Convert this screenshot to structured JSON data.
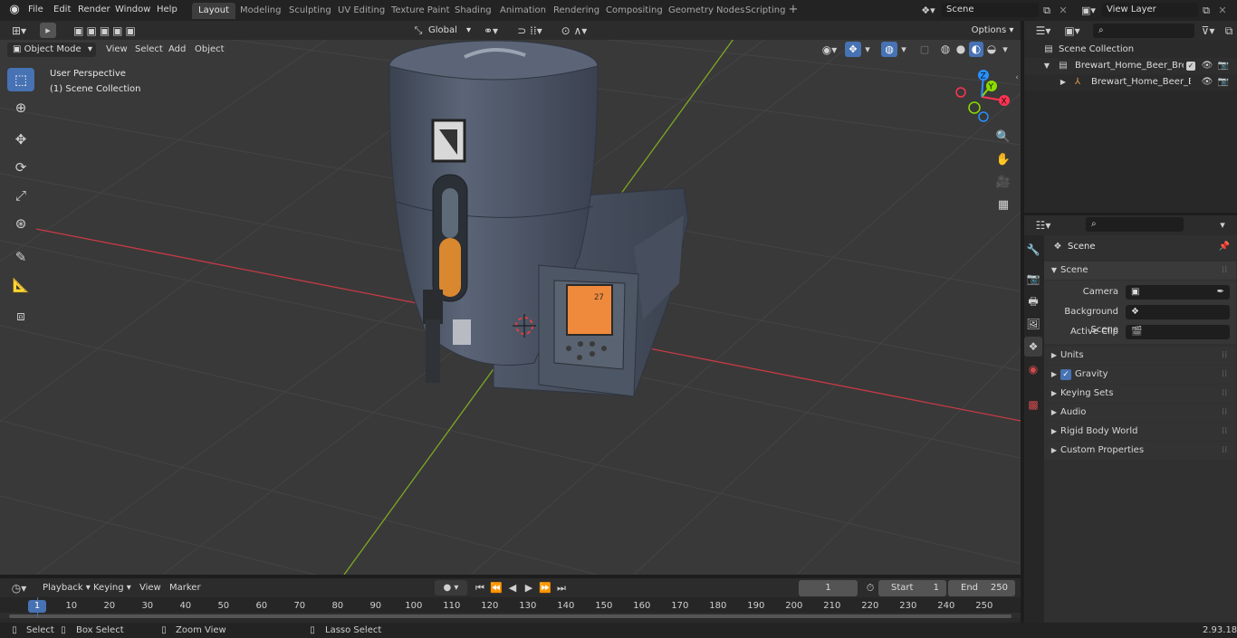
{
  "topbar": {
    "menus": [
      "File",
      "Edit",
      "Render",
      "Window",
      "Help"
    ],
    "workspaces": [
      "Layout",
      "Modeling",
      "Sculpting",
      "UV Editing",
      "Texture Paint",
      "Shading",
      "Animation",
      "Rendering",
      "Compositing",
      "Geometry Nodes",
      "Scripting"
    ],
    "active_workspace": "Layout",
    "scene_name": "Scene",
    "view_layer_name": "View Layer"
  },
  "viewport_header": {
    "mode": "Object Mode",
    "menus": [
      "View",
      "Select",
      "Add",
      "Object"
    ],
    "transform_orientation": "Global",
    "options_label": "Options"
  },
  "viewport": {
    "perspective_label": "User Perspective",
    "collection_label": "(1) Scene Collection",
    "gizmo_axes": [
      "X",
      "Y",
      "Z"
    ],
    "device_display": "27"
  },
  "outliner": {
    "root": "Scene Collection",
    "items": [
      {
        "label": "Brewart_Home_Beer_Brewing"
      },
      {
        "label": "Brewart_Home_Beer_Bre"
      }
    ]
  },
  "properties": {
    "context_title": "Scene",
    "panel_title": "Scene",
    "fields": [
      {
        "label": "Camera"
      },
      {
        "label": "Background Scene"
      },
      {
        "label": "Active Clip"
      }
    ],
    "subpanels": [
      "Units",
      "Gravity",
      "Keying Sets",
      "Audio",
      "Rigid Body World",
      "Custom Properties"
    ],
    "gravity_checked": true
  },
  "timeline": {
    "menus": [
      "Playback",
      "Keying",
      "View",
      "Marker"
    ],
    "current_frame": "1",
    "start_label": "Start",
    "start_value": "1",
    "end_label": "End",
    "end_value": "250",
    "ticks": [
      "1",
      "10",
      "20",
      "30",
      "40",
      "50",
      "60",
      "70",
      "80",
      "90",
      "100",
      "110",
      "120",
      "130",
      "140",
      "150",
      "160",
      "170",
      "180",
      "190",
      "200",
      "210",
      "220",
      "230",
      "240",
      "250"
    ]
  },
  "statusbar": {
    "select": "Select",
    "box_select": "Box Select",
    "zoom_view": "Zoom View",
    "lasso_select": "Lasso Select",
    "version": "2.93.18"
  },
  "colors": {
    "accent": "#4772b3",
    "x_axis": "#ff3352",
    "y_axis": "#8bdc00",
    "z_axis": "#2890ff"
  }
}
